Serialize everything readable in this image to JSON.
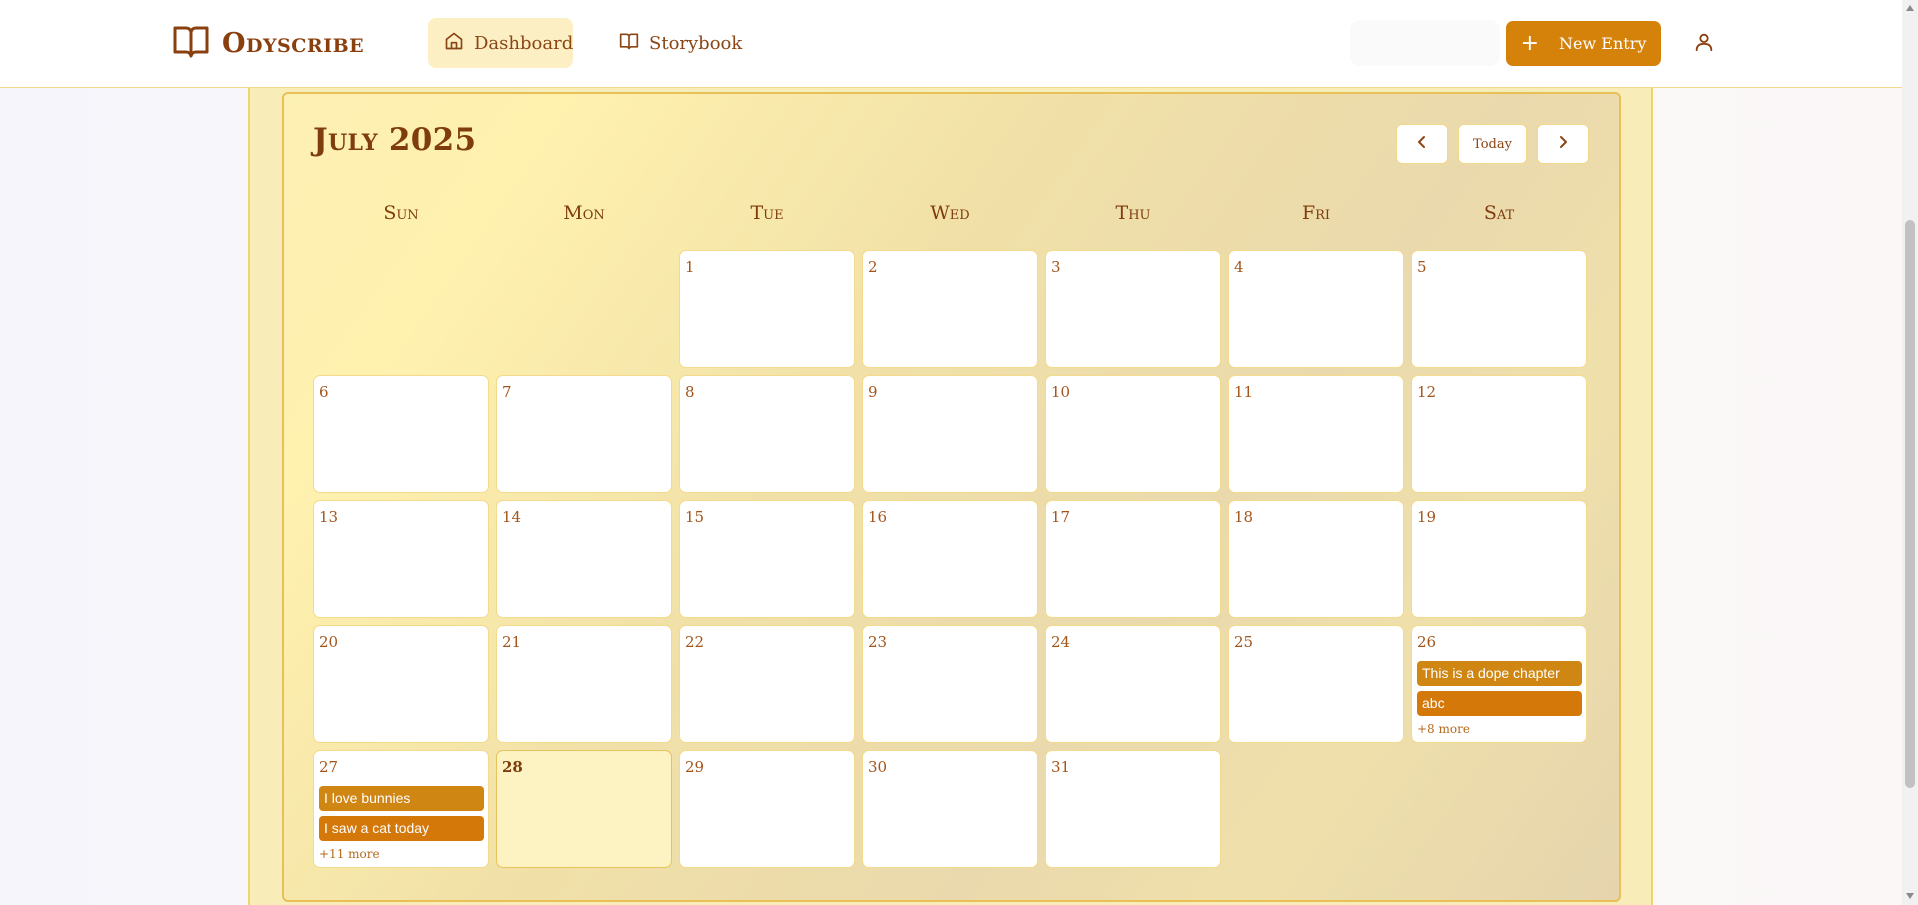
{
  "app": {
    "name": "Odyscribe"
  },
  "nav": {
    "dashboard": "Dashboard",
    "storybook": "Storybook"
  },
  "header": {
    "new_entry": "New Entry"
  },
  "calendar": {
    "title": "July 2025",
    "prev_label": "previous month",
    "today_label": "Today",
    "next_label": "next month",
    "weekdays": [
      "Sun",
      "Mon",
      "Tue",
      "Wed",
      "Thu",
      "Fri",
      "Sat"
    ],
    "days": {
      "d1": "1",
      "d2": "2",
      "d3": "3",
      "d4": "4",
      "d5": "5",
      "d6": "6",
      "d7": "7",
      "d8": "8",
      "d9": "9",
      "d10": "10",
      "d11": "11",
      "d12": "12",
      "d13": "13",
      "d14": "14",
      "d15": "15",
      "d16": "16",
      "d17": "17",
      "d18": "18",
      "d19": "19",
      "d20": "20",
      "d21": "21",
      "d22": "22",
      "d23": "23",
      "d24": "24",
      "d25": "25",
      "d26": "26",
      "d27": "27",
      "d28": "28",
      "d29": "29",
      "d30": "30",
      "d31": "31"
    },
    "entries": {
      "d26": [
        "This is a dope chapter",
        "abc"
      ],
      "d26_more": "+8 more",
      "d27": [
        "I love bunnies",
        "I saw a cat today"
      ],
      "d27_more": "+11 more"
    },
    "today_day": "28"
  },
  "colors": {
    "accent": "#d5820b",
    "brand_text": "#8a3f0e",
    "panel_bg": "#f1e1a8",
    "today_bg": "#fdf3c2"
  },
  "icons": {
    "logo": "open-book-icon",
    "dashboard": "home-icon",
    "storybook": "book-icon",
    "new_entry": "plus-icon",
    "user": "user-icon",
    "prev": "chevron-left-icon",
    "next": "chevron-right-icon"
  }
}
